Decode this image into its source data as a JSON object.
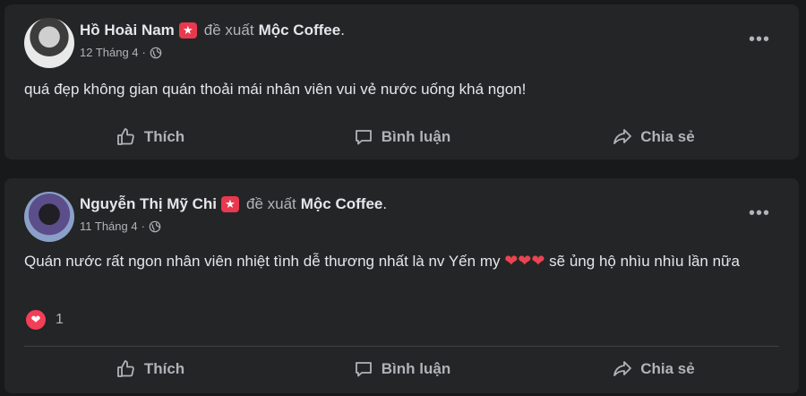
{
  "posts": [
    {
      "author": "Hồ Hoài Nam",
      "verb": "đề xuất",
      "page": "Mộc Coffee",
      "period": ".",
      "date": "12 Tháng 4",
      "separator": "·",
      "text": "quá đẹp không gian quán thoải mái nhân viên vui vẻ nước uống khá ngon!",
      "actions": {
        "like": "Thích",
        "comment": "Bình luận",
        "share": "Chia sẻ"
      }
    },
    {
      "author": "Nguyễn Thị Mỹ Chi",
      "verb": "đề xuất",
      "page": "Mộc Coffee",
      "period": ".",
      "date": "11 Tháng 4",
      "separator": "·",
      "text_before": "Quán nước rất ngon nhân viên nhiệt tình dễ thương nhất là nv Yến my ",
      "hearts": "❤❤❤",
      "text_after": " sẽ ủng hộ nhìu nhìu lần nữa",
      "reaction_count": "1",
      "actions": {
        "like": "Thích",
        "comment": "Bình luận",
        "share": "Chia sẻ"
      }
    }
  ],
  "icons": {
    "more": "more-options-icon",
    "globe": "globe-icon",
    "like": "thumbs-up-icon",
    "comment": "comment-icon",
    "share": "share-icon",
    "recommend_badge": "recommend-star-badge",
    "reaction": "love-reaction-icon"
  },
  "colors": {
    "background": "#18191a",
    "card": "#242526",
    "badge": "#e8394f",
    "love": "#f33e58"
  }
}
